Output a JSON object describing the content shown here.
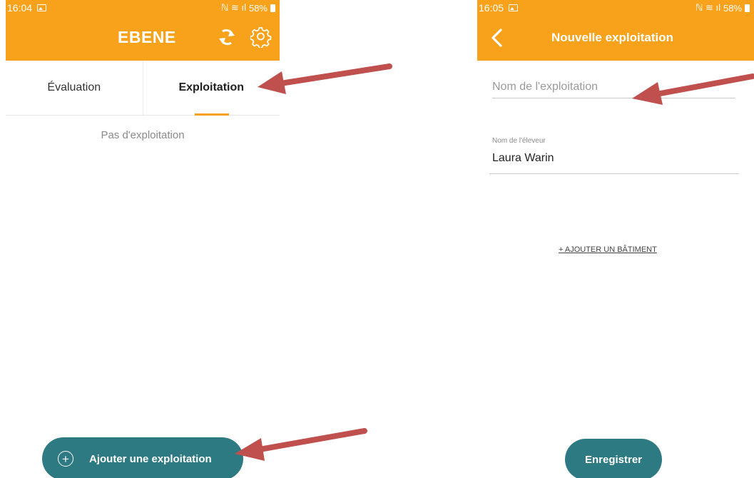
{
  "left_screen": {
    "status": {
      "time": "16:04",
      "battery": "58%"
    },
    "app_title": "EBENE",
    "tabs": [
      {
        "label": "Évaluation",
        "active": false
      },
      {
        "label": "Exploitation",
        "active": true
      }
    ],
    "empty_message": "Pas d'exploitation",
    "fab_label": "Ajouter une exploitation"
  },
  "right_screen": {
    "status": {
      "time": "16:05",
      "battery": "58%"
    },
    "title": "Nouvelle exploitation",
    "farm_name_placeholder": "Nom de l'exploitation",
    "breeder_label": "Nom de l'éleveur",
    "breeder_value": "Laura Warin",
    "add_building": "+ AJOUTER UN BÂTIMENT",
    "save_label": "Enregistrer"
  },
  "icons": {
    "sync": "sync-icon",
    "settings": "gear-icon",
    "back": "chevron-left-icon",
    "add": "plus-circle-icon"
  },
  "colors": {
    "header": "#f7a21a",
    "primary_button": "#2e7a83",
    "annotation_arrow": "#c0504d"
  }
}
